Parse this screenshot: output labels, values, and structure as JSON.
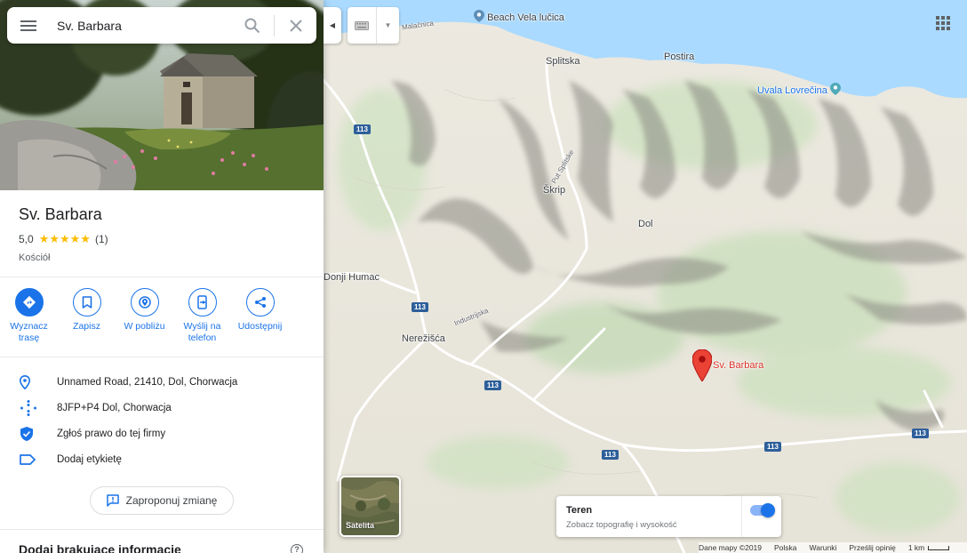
{
  "search": {
    "value": "Sv. Barbara"
  },
  "place": {
    "name": "Sv. Barbara",
    "rating": "5,0",
    "stars": "★★★★★",
    "reviews": "(1)",
    "category": "Kościół"
  },
  "actions": [
    {
      "label": "Wyznacz trasę",
      "icon": "directions-icon"
    },
    {
      "label": "Zapisz",
      "icon": "bookmark-icon"
    },
    {
      "label": "W pobliżu",
      "icon": "nearby-icon"
    },
    {
      "label": "Wyślij na telefon",
      "icon": "send-to-phone-icon"
    },
    {
      "label": "Udostępnij",
      "icon": "share-icon"
    }
  ],
  "info": {
    "address": "Unnamed Road, 21410, Dol, Chorwacja",
    "plus_code": "8JFP+P4 Dol, Chorwacja",
    "claim": "Zgłoś prawo do tej firmy",
    "label": "Dodaj etykietę"
  },
  "suggest_edit": "Zaproponuj zmianę",
  "add_info": "Dodaj brakujące informacje",
  "map": {
    "labels": {
      "beach": "Beach Vela lučica",
      "malacnica": "Malačnica",
      "splitska": "Splitska",
      "postira": "Postira",
      "uvala": "Uvala Lovrečina",
      "skrip": "Škrip",
      "dol": "Dol",
      "donji_humac": "Donji Humac",
      "nerezisca": "Nerežišća",
      "pin_label": "Sv. Barbara",
      "put_splitske": "Put Splitske",
      "industrijska": "Industrijska"
    },
    "road_number": "113"
  },
  "satellite": "Satelita",
  "terrain": {
    "title": "Teren",
    "subtitle": "Zobacz topografię i wysokość",
    "enabled": true
  },
  "footer": {
    "data": "Dane mapy ©2019",
    "country": "Polska",
    "terms": "Warunki",
    "feedback": "Prześlij opinię",
    "scale": "1 km"
  },
  "colors": {
    "accent": "#1a73e8",
    "pin": "#d93025",
    "star": "#fbbc04",
    "road_shield": "#2d5f9a",
    "sea": "#aadaff"
  }
}
